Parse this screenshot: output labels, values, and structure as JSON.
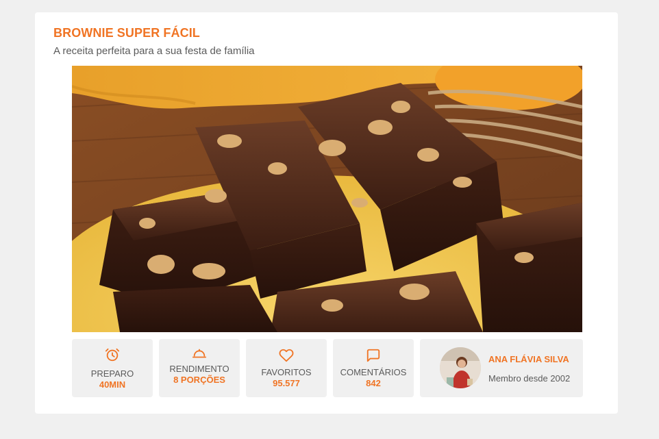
{
  "recipe": {
    "title": "BROWNIE SUPER FÁCIL",
    "subtitle": "A receita perfeita para a sua festa de família",
    "image_alt": "brownie photo"
  },
  "stats": [
    {
      "icon": "alarm-clock-icon",
      "label": "PREPARO",
      "value": "40MIN"
    },
    {
      "icon": "cloche-icon",
      "label": "RENDIMENTO",
      "value": "8 PORÇÕES"
    },
    {
      "icon": "heart-icon",
      "label": "FAVORITOS",
      "value": "95.577"
    },
    {
      "icon": "speech-bubble-icon",
      "label": "COMENTÁRIOS",
      "value": "842"
    }
  ],
  "author": {
    "name": "ANA FLÁVIA SILVA",
    "member_since": "Membro desde 2002"
  },
  "colors": {
    "accent": "#f07424",
    "text": "#5a5a5a",
    "page_bg": "#f0f0f0",
    "card_bg": "#ffffff"
  }
}
